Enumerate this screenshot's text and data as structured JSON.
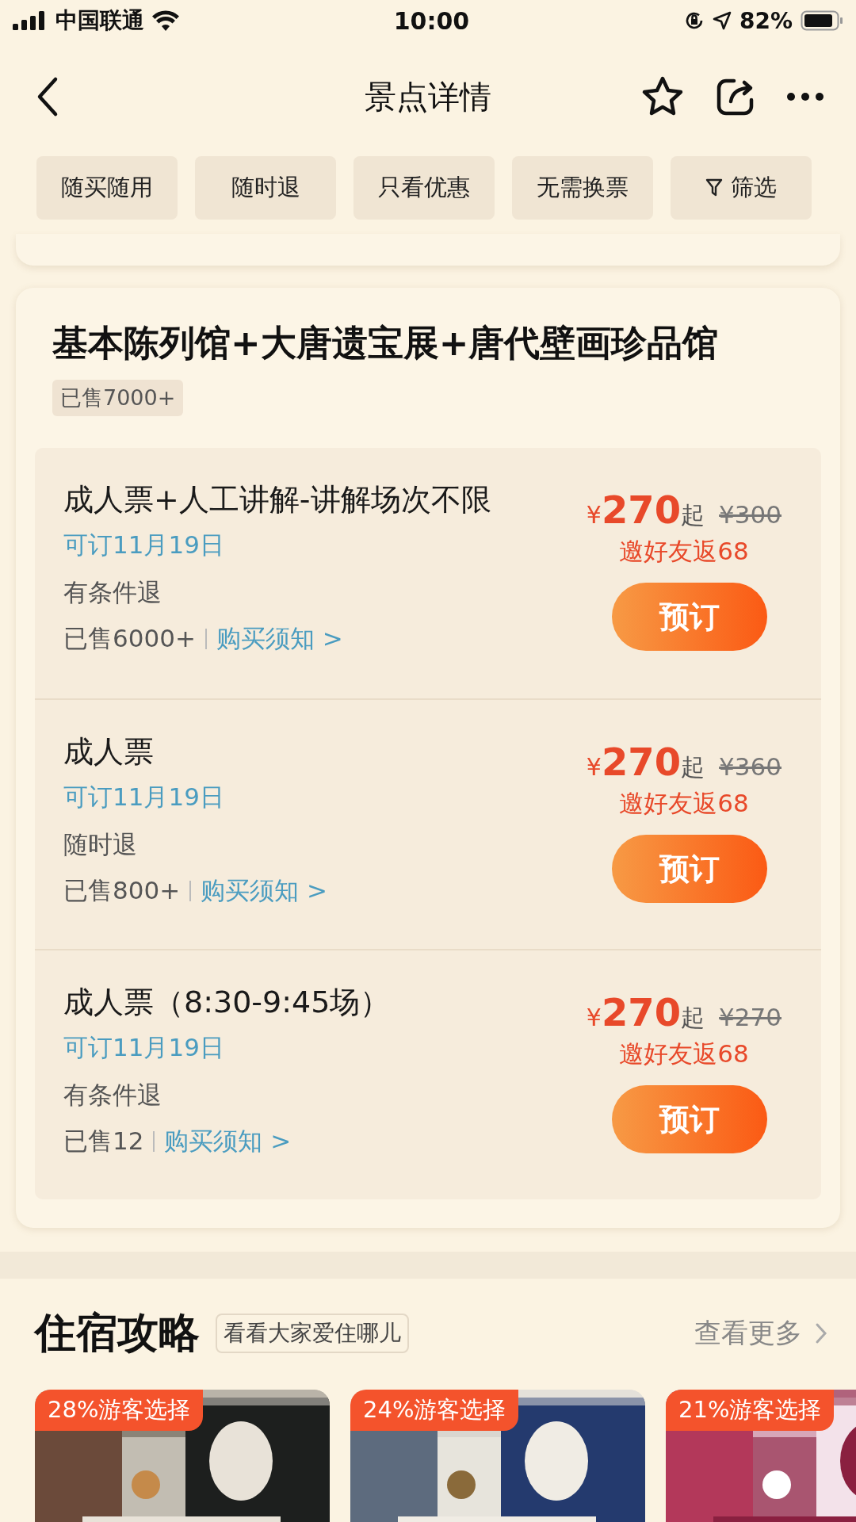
{
  "status_bar": {
    "carrier": "中国联通",
    "time": "10:00",
    "battery": "82%"
  },
  "nav": {
    "title": "景点详情"
  },
  "filters": [
    {
      "label": "随买随用",
      "kind": "tag"
    },
    {
      "label": "随时退",
      "kind": "tag"
    },
    {
      "label": "只看优惠",
      "kind": "tag"
    },
    {
      "label": "无需换票",
      "kind": "tag"
    },
    {
      "label": "筛选",
      "kind": "filter"
    }
  ],
  "package": {
    "title": "基本陈列馆+大唐遗宝展+唐代壁画珍品馆",
    "sold": "已售7000+",
    "tickets": [
      {
        "name": "成人票+人工讲解-讲解场次不限",
        "date": "可订11月19日",
        "refund": "有条件退",
        "sold": "已售6000+",
        "notice": "购买须知 >",
        "currency": "¥",
        "price": "270",
        "price_suffix": "起",
        "original_price": "¥300",
        "rebate": "邀好友返68",
        "button": "预订"
      },
      {
        "name": "成人票",
        "date": "可订11月19日",
        "refund": "随时退",
        "sold": "已售800+",
        "notice": "购买须知 >",
        "currency": "¥",
        "price": "270",
        "price_suffix": "起",
        "original_price": "¥360",
        "rebate": "邀好友返68",
        "button": "预订"
      },
      {
        "name": "成人票（8:30-9:45场）",
        "date": "可订11月19日",
        "refund": "有条件退",
        "sold": "已售12",
        "notice": "购买须知 >",
        "currency": "¥",
        "price": "270",
        "price_suffix": "起",
        "original_price": "¥270",
        "rebate": "邀好友返68",
        "button": "预订"
      }
    ]
  },
  "lodging": {
    "title": "住宿攻略",
    "subtitle": "看看大家爱住哪儿",
    "more": "查看更多",
    "hotels": [
      {
        "badge": "28%游客选择",
        "kind": "picture"
      },
      {
        "badge": "24%游客选择",
        "kind": "picture"
      },
      {
        "badge": "21%游客选择",
        "kind": "picture"
      }
    ]
  }
}
